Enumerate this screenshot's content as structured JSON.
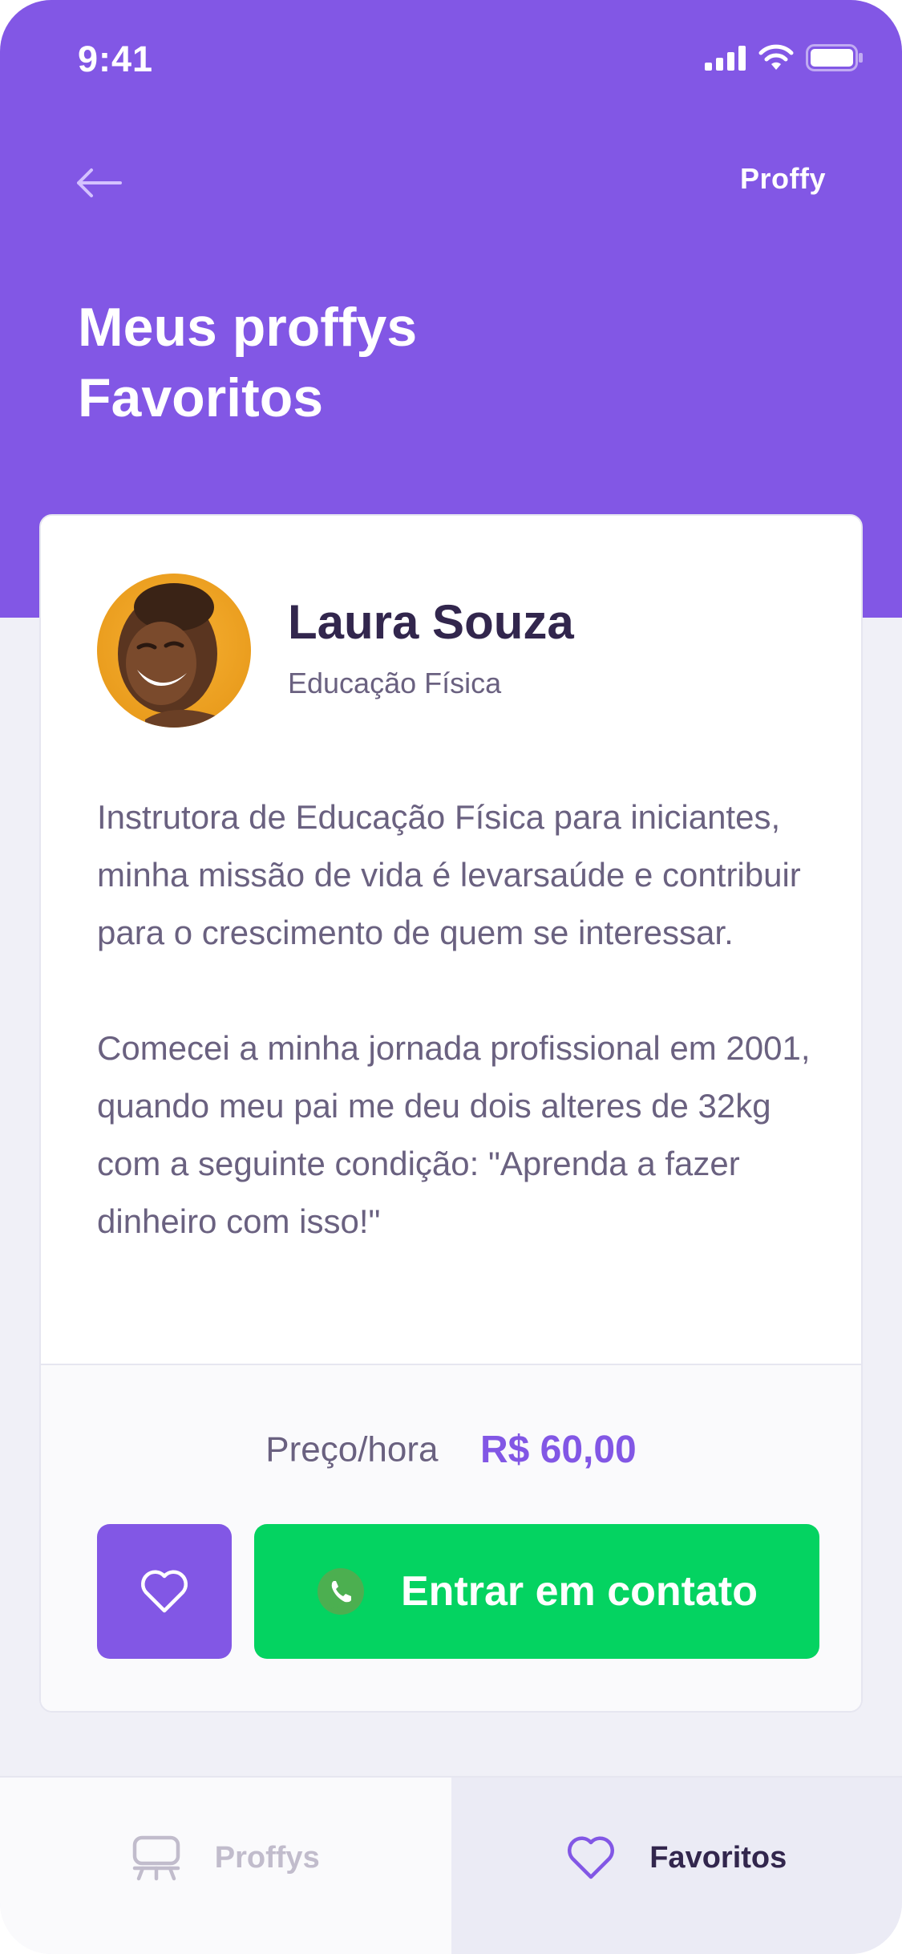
{
  "status_bar": {
    "time": "9:41"
  },
  "header": {
    "logo": "Proffy",
    "title_line1": "Meus proffys",
    "title_line2": "Favoritos"
  },
  "teacher": {
    "name": "Laura Souza",
    "subject": "Educação Física",
    "bio_paragraphs": [
      "Instrutora de Educação Física para iniciantes, minha missão de vida é levarsaúde e contribuir para o crescimento de quem se interessar.",
      "Comecei a minha jornada profissional em 2001, quando meu pai me deu dois alteres de 32kg com a seguinte condição: \"Aprenda a fazer dinheiro com isso!\""
    ],
    "price_label": "Preço/hora",
    "price_value": "R$ 60,00"
  },
  "actions": {
    "contact_label": "Entrar em contato"
  },
  "tabbar": {
    "tabs": [
      {
        "label": "Proffys",
        "active": false
      },
      {
        "label": "Favoritos",
        "active": true
      }
    ]
  },
  "colors": {
    "primary": "#8257E5",
    "green": "#04D361",
    "title": "#32264D",
    "text": "#6A6180",
    "background": "#F0F0F7"
  },
  "icons": {
    "back": "arrow-left-icon",
    "favorite": "heart-icon",
    "contact": "whatsapp-icon",
    "tab_proffys": "easel-icon",
    "tab_favoritos": "heart-icon"
  }
}
